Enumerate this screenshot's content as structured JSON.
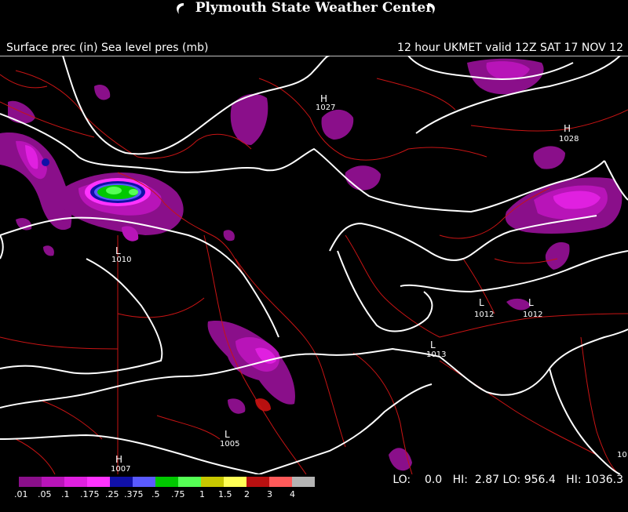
{
  "header": {
    "title": "Plymouth State Weather Center"
  },
  "subtitle": {
    "left": "Surface prec (in) Sea level pres (mb)",
    "right": "12 hour UKMET valid 12Z SAT 17 NOV 12"
  },
  "centers": [
    {
      "type": "H",
      "value": "1027"
    },
    {
      "type": "H",
      "value": "1028"
    },
    {
      "type": "L",
      "value": "1010"
    },
    {
      "type": "L",
      "value": "1012"
    },
    {
      "type": "L",
      "value": "1012"
    },
    {
      "type": "L",
      "value": "1013"
    },
    {
      "type": "L",
      "value": "1005"
    },
    {
      "type": "H",
      "value": "1007"
    },
    {
      "type": "",
      "value": "10"
    }
  ],
  "legend": {
    "labels": [
      ".01",
      ".05",
      ".1",
      ".175",
      ".25",
      ".375",
      ".5",
      ".75",
      "1",
      "1.5",
      "2",
      "3",
      "4"
    ],
    "colors": [
      "#8a0f8a",
      "#b814b8",
      "#e020e0",
      "#ff33ff",
      "#1010a8",
      "#5a5aff",
      "#00c800",
      "#55ff55",
      "#c8c800",
      "#ffff55",
      "#b81010",
      "#ff5a5a",
      "#b4b4b4"
    ]
  },
  "stats": {
    "lo_prec_label": "LO:",
    "lo_prec": "0.0",
    "hi_prec_label": "HI:",
    "hi_prec": "2.87",
    "lo_pres_label": "LO:",
    "lo_pres": "956.4",
    "hi_pres_label": "HI:",
    "hi_pres": "1036.3"
  }
}
